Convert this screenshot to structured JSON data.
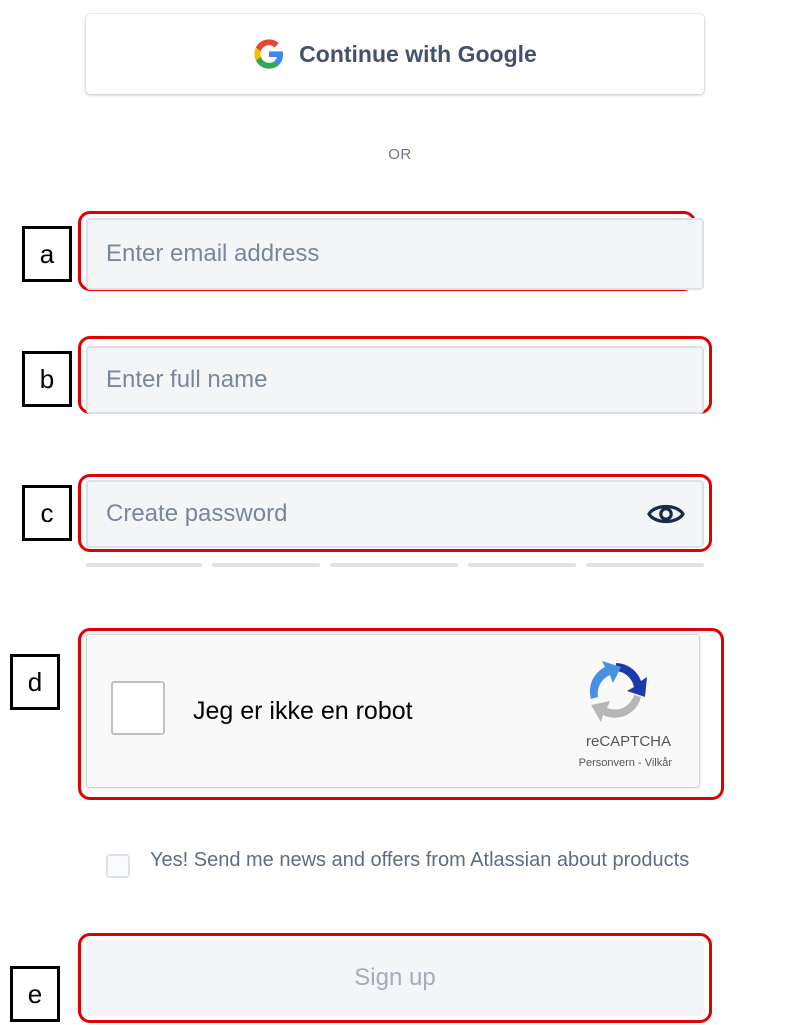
{
  "google_button": {
    "label": "Continue with Google",
    "icon": "google-g-icon"
  },
  "divider": {
    "text": "OR"
  },
  "markers": [
    "a",
    "b",
    "c",
    "d",
    "e"
  ],
  "fields": {
    "email": {
      "placeholder": "Enter email address",
      "value": ""
    },
    "full_name": {
      "placeholder": "Enter full name",
      "value": ""
    },
    "password": {
      "placeholder": "Create password",
      "value": "",
      "toggle_icon": "eye-icon"
    }
  },
  "password_strength": {
    "segments": 5,
    "filled": 0
  },
  "captcha": {
    "label": "Jeg er ikke en robot",
    "checked": false,
    "brand": "reCAPTCHA",
    "privacy_link": "Personvern",
    "separator": " - ",
    "terms_link": "Vilkår"
  },
  "newsletter": {
    "checked": false,
    "label": "Yes! Send me news and offers from Atlassian about products"
  },
  "signup_button": {
    "label": "Sign up",
    "disabled": true
  },
  "colors": {
    "highlight": "#e00000",
    "field_bg": "#f4f5f7",
    "muted_text": "#7a869a"
  }
}
